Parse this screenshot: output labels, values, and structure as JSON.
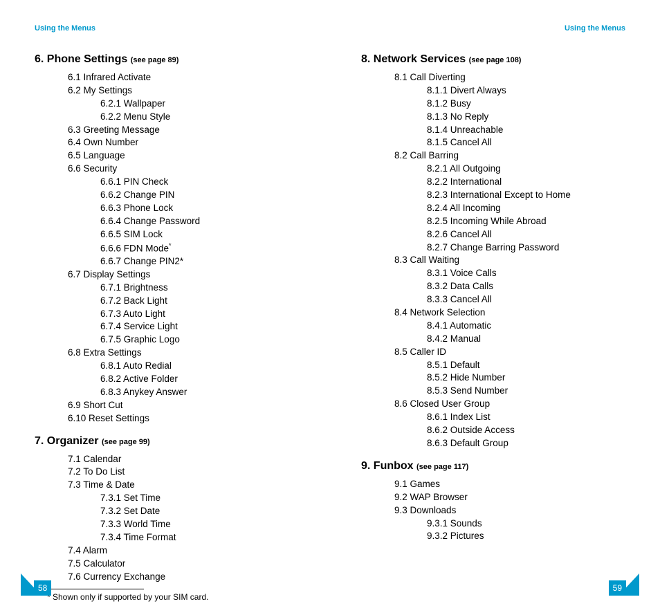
{
  "header": {
    "left": "Using the Menus",
    "right": "Using the Menus"
  },
  "sections": {
    "s6": {
      "num": "6.",
      "title": "Phone Settings",
      "pageref": "(see page 89)",
      "items": [
        {
          "num": "6.1",
          "label": "Infrared Activate"
        },
        {
          "num": "6.2",
          "label": "My Settings",
          "children": [
            {
              "num": "6.2.1",
              "label": "Wallpaper"
            },
            {
              "num": "6.2.2",
              "label": "Menu Style"
            }
          ]
        },
        {
          "num": "6.3",
          "label": "Greeting Message"
        },
        {
          "num": "6.4",
          "label": "Own Number"
        },
        {
          "num": "6.5",
          "label": "Language"
        },
        {
          "num": "6.6",
          "label": "Security",
          "children": [
            {
              "num": "6.6.1",
              "label": "PIN Check"
            },
            {
              "num": "6.6.2",
              "label": "Change PIN"
            },
            {
              "num": "6.6.3",
              "label": "Phone Lock"
            },
            {
              "num": "6.6.4",
              "label": "Change Password"
            },
            {
              "num": "6.6.5",
              "label": "SIM Lock"
            },
            {
              "num": "6.6.6",
              "label": "FDN Mode",
              "sup": "*"
            },
            {
              "num": "6.6.7",
              "label": "Change PIN2*"
            }
          ]
        },
        {
          "num": "6.7",
          "label": "Display Settings",
          "children": [
            {
              "num": "6.7.1",
              "label": "Brightness"
            },
            {
              "num": "6.7.2",
              "label": "Back Light"
            },
            {
              "num": "6.7.3",
              "label": "Auto Light"
            },
            {
              "num": "6.7.4",
              "label": "Service Light"
            },
            {
              "num": "6.7.5",
              "label": "Graphic Logo"
            }
          ]
        },
        {
          "num": "6.8",
          "label": "Extra Settings",
          "children": [
            {
              "num": "6.8.1",
              "label": "Auto Redial"
            },
            {
              "num": "6.8.2",
              "label": "Active Folder"
            },
            {
              "num": "6.8.3",
              "label": "Anykey Answer"
            }
          ]
        },
        {
          "num": "6.9",
          "label": "Short Cut"
        },
        {
          "num": "6.10",
          "label": "Reset Settings"
        }
      ]
    },
    "s7": {
      "num": "7.",
      "title": "Organizer",
      "pageref": "(see page 99)",
      "items": [
        {
          "num": "7.1",
          "label": "Calendar"
        },
        {
          "num": "7.2",
          "label": "To Do List"
        },
        {
          "num": "7.3",
          "label": "Time & Date",
          "children": [
            {
              "num": "7.3.1",
              "label": "Set Time"
            },
            {
              "num": "7.3.2",
              "label": "Set Date"
            },
            {
              "num": "7.3.3",
              "label": "World Time"
            },
            {
              "num": "7.3.4",
              "label": "Time Format"
            }
          ]
        },
        {
          "num": "7.4",
          "label": "Alarm"
        },
        {
          "num": "7.5",
          "label": "Calculator"
        },
        {
          "num": "7.6",
          "label": "Currency Exchange"
        }
      ]
    },
    "s8": {
      "num": "8.",
      "title": "Network Services",
      "pageref": "(see page 108)",
      "items": [
        {
          "num": "8.1",
          "label": "Call Diverting",
          "children": [
            {
              "num": "8.1.1",
              "label": "Divert Always"
            },
            {
              "num": "8.1.2",
              "label": "Busy"
            },
            {
              "num": "8.1.3",
              "label": "No Reply"
            },
            {
              "num": "8.1.4",
              "label": "Unreachable"
            },
            {
              "num": "8.1.5",
              "label": "Cancel All"
            }
          ]
        },
        {
          "num": "8.2",
          "label": "Call Barring",
          "children": [
            {
              "num": "8.2.1",
              "label": "All Outgoing"
            },
            {
              "num": "8.2.2",
              "label": "International"
            },
            {
              "num": "8.2.3",
              "label": "International Except to Home"
            },
            {
              "num": "8.2.4",
              "label": "All Incoming"
            },
            {
              "num": "8.2.5",
              "label": "Incoming While Abroad"
            },
            {
              "num": "8.2.6",
              "label": "Cancel All"
            },
            {
              "num": "8.2.7",
              "label": "Change Barring Password"
            }
          ]
        },
        {
          "num": "8.3",
          "label": "Call Waiting",
          "children": [
            {
              "num": "8.3.1",
              "label": "Voice Calls"
            },
            {
              "num": "8.3.2",
              "label": "Data Calls"
            },
            {
              "num": "8.3.3",
              "label": "Cancel All"
            }
          ]
        },
        {
          "num": "8.4",
          "label": "Network Selection",
          "children": [
            {
              "num": "8.4.1",
              "label": "Automatic"
            },
            {
              "num": "8.4.2",
              "label": "Manual"
            }
          ]
        },
        {
          "num": "8.5",
          "label": "Caller ID",
          "children": [
            {
              "num": "8.5.1",
              "label": "Default"
            },
            {
              "num": "8.5.2",
              "label": "Hide Number"
            },
            {
              "num": "8.5.3",
              "label": "Send Number"
            }
          ]
        },
        {
          "num": "8.6",
          "label": "Closed User Group",
          "children": [
            {
              "num": "8.6.1",
              "label": "Index List"
            },
            {
              "num": "8.6.2",
              "label": "Outside Access"
            },
            {
              "num": "8.6.3",
              "label": "Default Group"
            }
          ]
        }
      ]
    },
    "s9": {
      "num": "9.",
      "title": "Funbox",
      "pageref": "(see page 117)",
      "items": [
        {
          "num": "9.1",
          "label": "Games"
        },
        {
          "num": "9.2",
          "label": "WAP Browser"
        },
        {
          "num": "9.3",
          "label": "Downloads",
          "children": [
            {
              "num": "9.3.1",
              "label": "Sounds"
            },
            {
              "num": "9.3.2",
              "label": "Pictures"
            }
          ]
        }
      ]
    }
  },
  "footnote": "* Shown only if supported by your SIM card.",
  "page_numbers": {
    "left": "58",
    "right": "59"
  }
}
